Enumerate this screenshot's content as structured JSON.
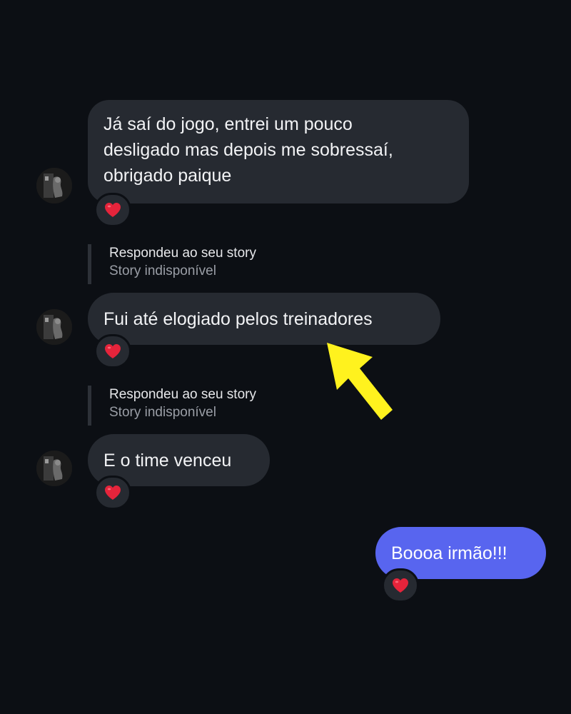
{
  "messages": [
    {
      "sender": "other",
      "lines": [
        "Já saí do jogo, entrei um pouco",
        "desligado mas depois me sobressaí,",
        "obrigado paique"
      ],
      "reaction": "heart"
    },
    {
      "sender": "other",
      "reply": {
        "title": "Respondeu ao seu story",
        "subtitle": "Story indisponível"
      },
      "text": "Fui até elogiado pelos treinadores",
      "reaction": "heart"
    },
    {
      "sender": "other",
      "reply": {
        "title": "Respondeu ao seu story",
        "subtitle": "Story indisponível"
      },
      "text": "E o time venceu",
      "reaction": "heart"
    },
    {
      "sender": "me",
      "text": "Boooa irmão!!!",
      "reaction": "heart"
    }
  ],
  "colors": {
    "background": "#0c0f14",
    "incoming_bubble": "#262a31",
    "outgoing_bubble": "#5865ef",
    "reaction_heart": "#e5243b",
    "annotation_arrow": "#fff21e"
  },
  "icons": {
    "reaction": "heart-icon",
    "avatar": "user-avatar",
    "annotation": "arrow-icon"
  }
}
